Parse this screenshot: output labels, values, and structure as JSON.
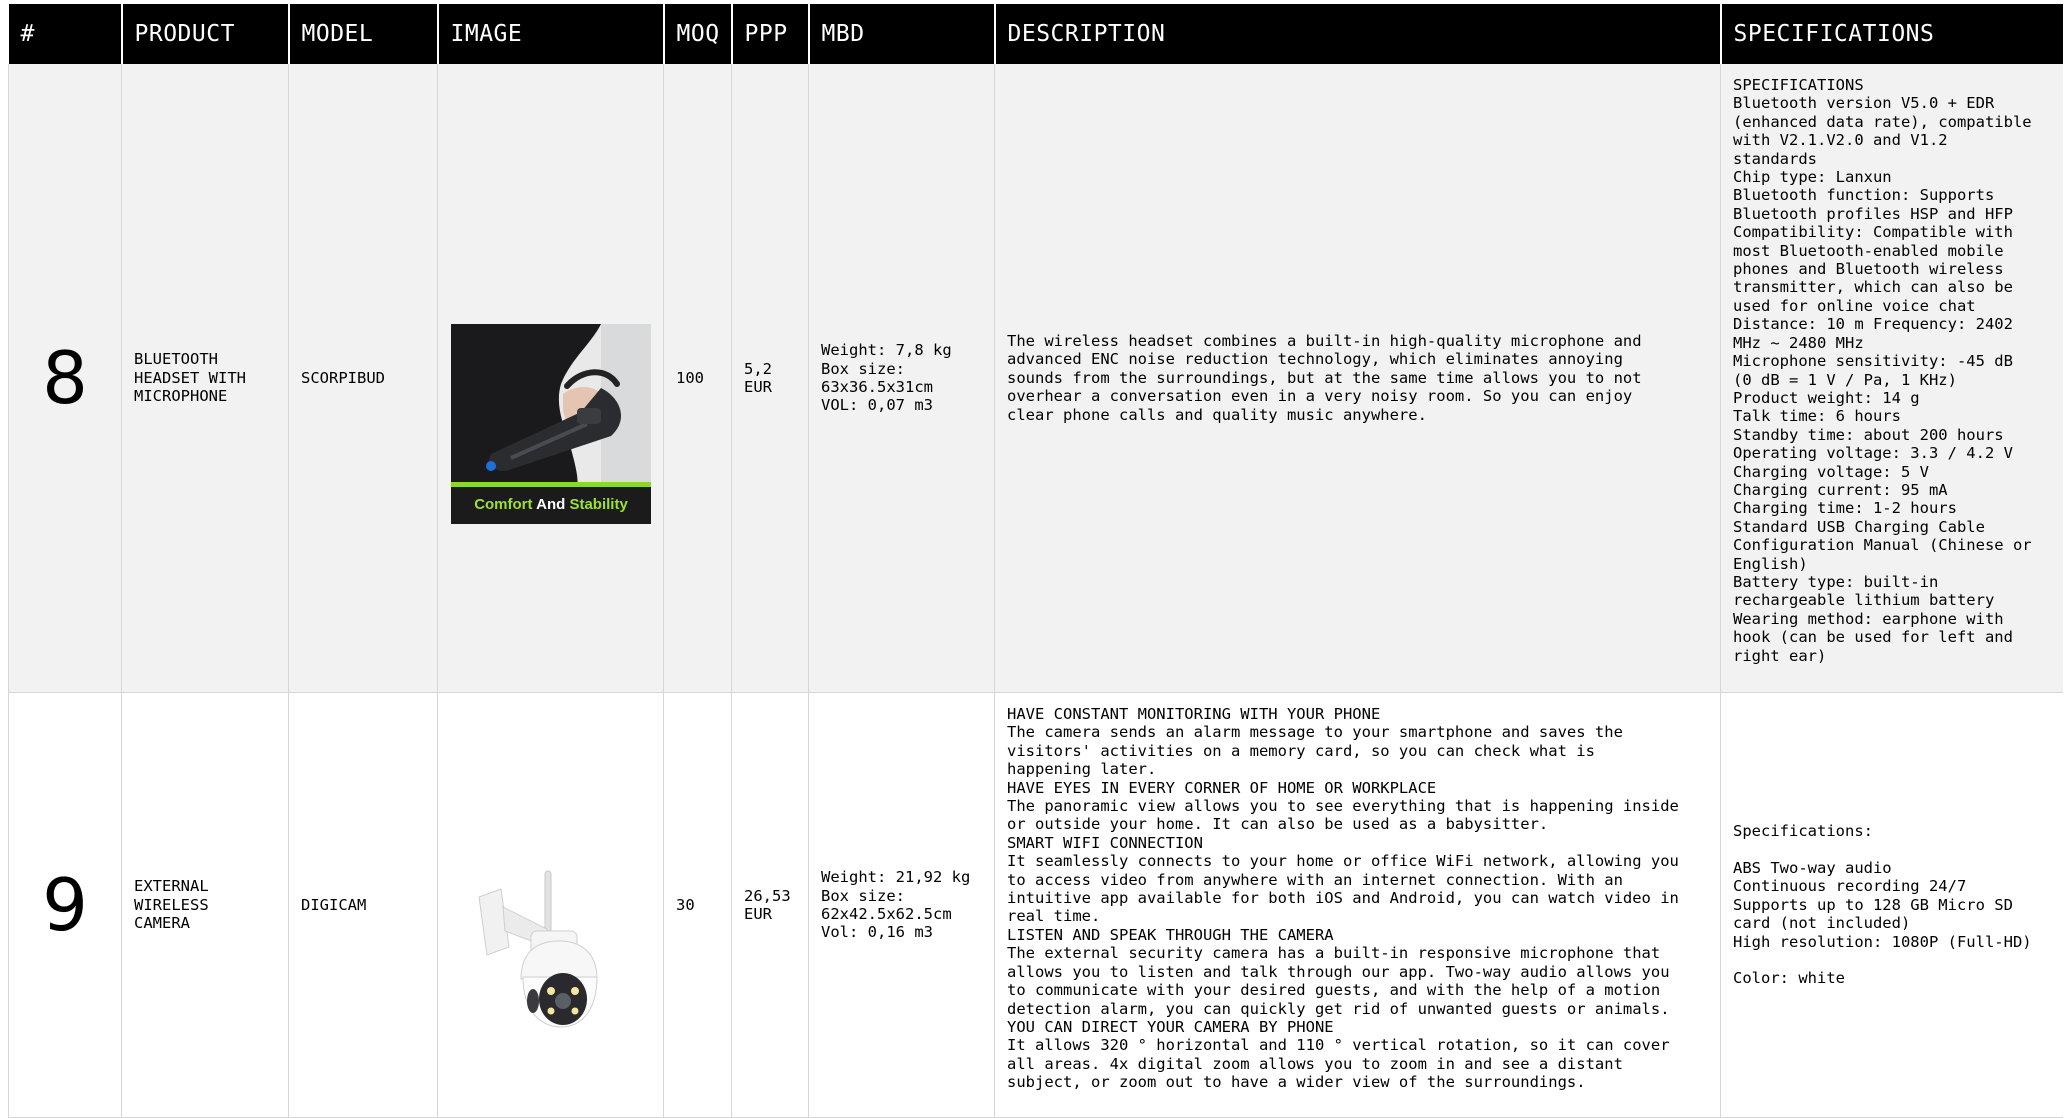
{
  "header": {
    "num": "#",
    "product": "PRODUCT",
    "model": "MODEL",
    "image": "IMAGE",
    "moq": "MOQ",
    "ppp": "PPP",
    "mbd": "MBD",
    "description": "DESCRIPTION",
    "specifications": "SPECIFICATIONS"
  },
  "rows": [
    {
      "num": "8",
      "product": "BLUETOOTH\nHEADSET WITH\nMICROPHONE",
      "model": "SCORPIBUD",
      "image_caption": "Comfort And Stability",
      "moq": "100",
      "ppp": "5,2\nEUR",
      "mbd": "Weight: 7,8 kg\nBox size:\n63x36.5x31cm\nVOL: 0,07 m3",
      "description": "The wireless headset combines a built-in high-quality microphone and\nadvanced ENC noise reduction technology, which eliminates annoying\nsounds from the surroundings, but at the same time allows you to not\noverhear a conversation even in a very noisy room. So you can enjoy\nclear phone calls and quality music anywhere.",
      "specifications": "SPECIFICATIONS\nBluetooth version V5.0 + EDR\n(enhanced data rate), compatible\nwith V2.1.V2.0 and V1.2\nstandards\nChip type: Lanxun\nBluetooth function: Supports\nBluetooth profiles HSP and HFP\nCompatibility: Compatible with\nmost Bluetooth-enabled mobile\nphones and Bluetooth wireless\ntransmitter, which can also be\nused for online voice chat\nDistance: 10 m Frequency: 2402\nMHz ~ 2480 MHz\nMicrophone sensitivity: -45 dB\n(0 dB = 1 V / Pa, 1 KHz)\nProduct weight: 14 g\nTalk time: 6 hours\nStandby time: about 200 hours\nOperating voltage: 3.3 / 4.2 V\nCharging voltage: 5 V\nCharging current: 95 mA\nCharging time: 1-2 hours\nStandard USB Charging Cable\nConfiguration Manual (Chinese or\nEnglish)\nBattery type: built-in\nrechargeable lithium battery\nWearing method: earphone with\nhook (can be used for left and\nright ear)"
    },
    {
      "num": "9",
      "product": "EXTERNAL\nWIRELESS\nCAMERA",
      "model": "DIGICAM",
      "moq": "30",
      "ppp": "26,53\nEUR",
      "mbd": "Weight: 21,92 kg\nBox size:\n62x42.5x62.5cm\nVol: 0,16 m3",
      "description": "HAVE CONSTANT MONITORING WITH YOUR PHONE\nThe camera sends an alarm message to your smartphone and saves the\nvisitors' activities on a memory card, so you can check what is\nhappening later.\nHAVE EYES IN EVERY CORNER OF HOME OR WORKPLACE\nThe panoramic view allows you to see everything that is happening inside\nor outside your home. It can also be used as a babysitter.\nSMART WIFI CONNECTION\nIt seamlessly connects to your home or office WiFi network, allowing you\nto access video from anywhere with an internet connection. With an\nintuitive app available for both iOS and Android, you can watch video in\nreal time.\nLISTEN AND SPEAK THROUGH THE CAMERA\nThe external security camera has a built-in responsive microphone that\nallows you to listen and talk through our app. Two-way audio allows you\nto communicate with your desired guests, and with the help of a motion\ndetection alarm, you can quickly get rid of unwanted guests or animals.\nYOU CAN DIRECT YOUR CAMERA BY PHONE\nIt allows 320 ° horizontal and 110 ° vertical rotation, so it can cover\nall areas. 4x digital zoom allows you to zoom in and see a distant\nsubject, or zoom out to have a wider view of the surroundings.",
      "specifications": "Specifications:\n\nABS Two-way audio\nContinuous recording 24/7\nSupports up to 128 GB Micro SD\ncard (not included)\nHigh resolution: 1080P (Full-HD)\n\nColor: white"
    }
  ],
  "colors": {
    "header_bg": "#000000",
    "header_text": "#ffffff",
    "row_alt_bg": "#f2f2f2",
    "caption_green": "#9be12f"
  }
}
